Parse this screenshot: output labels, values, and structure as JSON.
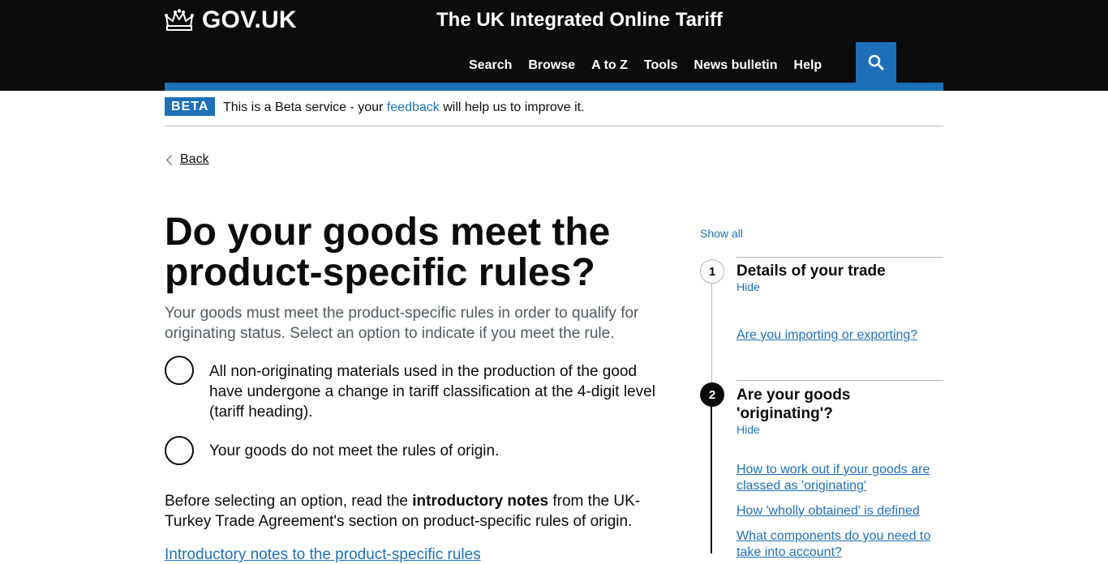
{
  "header": {
    "logo_text": "GOV.UK",
    "service_name": "The UK Integrated Online Tariff",
    "nav": [
      "Search",
      "Browse",
      "A to Z",
      "Tools",
      "News bulletin",
      "Help"
    ],
    "search_icon": "search-icon"
  },
  "beta": {
    "tag": "BETA",
    "text_before": "This is a Beta service - your ",
    "link": "feedback",
    "text_after": " will help us to improve it."
  },
  "back_link": "Back",
  "main": {
    "title": "Do your goods meet the product-specific rules?",
    "lead": "Your goods must meet the product-specific rules in order to qualify for originating status. Select an option to indicate if you meet the rule.",
    "options": [
      "All non-originating materials used in the production of the good have undergone a change in tariff classification at the 4-digit level (tariff heading).",
      "Your goods do not meet the rules of origin."
    ],
    "notes_before": "Before selecting an option, read the ",
    "notes_bold": "introductory notes",
    "notes_after": " from the UK-Turkey Trade Agreement's section on product-specific rules of origin.",
    "notes_link": "Introductory notes to the product-specific rules"
  },
  "step_nav": {
    "show_all": "Show all",
    "steps": [
      {
        "number": "1",
        "title": "Details of your trade",
        "toggle": "Hide",
        "links": [
          "Are you importing or exporting?"
        ]
      },
      {
        "number": "2",
        "title": "Are your goods 'originating'?",
        "toggle": "Hide",
        "links": [
          "How to work out if your goods are classed as 'originating'",
          "How 'wholly obtained' is defined",
          "What components do you need to take into account?"
        ]
      }
    ]
  },
  "colors": {
    "header_bg": "#0b0c0c",
    "accent": "#1d70b8",
    "text": "#0b0c0c",
    "secondary_text": "#505a5f",
    "border": "#b1b4b6"
  }
}
